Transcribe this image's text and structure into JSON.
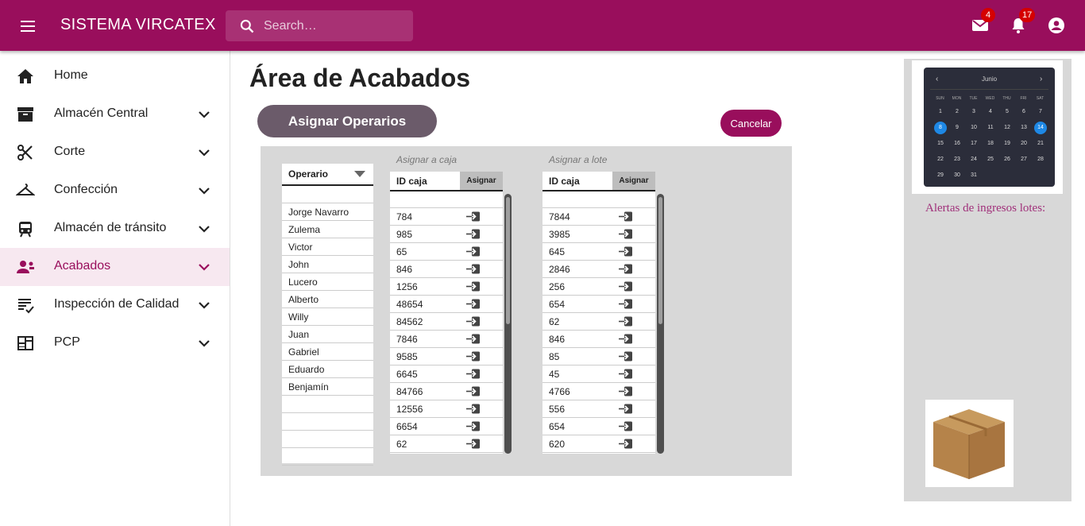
{
  "app": {
    "title": "SISTEMA VIRCATEX",
    "search_placeholder": "Search…",
    "mail_badge": "4",
    "notifications_badge": "17",
    "accent_color": "#990e5c"
  },
  "sidebar": {
    "items": [
      {
        "label": "Home",
        "icon": "home-icon"
      },
      {
        "label": "Almacén Central",
        "icon": "archive-icon"
      },
      {
        "label": "Corte",
        "icon": "scissors-icon"
      },
      {
        "label": "Confección",
        "icon": "hanger-icon"
      },
      {
        "label": "Almacén de tránsito",
        "icon": "train-icon"
      },
      {
        "label": "Acabados",
        "icon": "workers-icon",
        "active": true
      },
      {
        "label": "Inspección de Calidad",
        "icon": "checklist-icon"
      },
      {
        "label": "PCP",
        "icon": "dashboard-icon"
      }
    ]
  },
  "main": {
    "title": "Área de Acabados",
    "assign_button": "Asignar Operarios",
    "cancel_button": "Cancelar",
    "operators": {
      "header": "Operario",
      "items": [
        "Jorge Navarro",
        "Zulema",
        "Victor",
        "John",
        "Lucero",
        "Alberto",
        "Willy",
        "Juan",
        "Gabriel",
        "Eduardo",
        "Benjamín"
      ]
    },
    "box_table": {
      "caption": "Asignar a caja",
      "col_id": "ID caja",
      "col_action": "Asignar",
      "rows": [
        "784",
        "985",
        "65",
        "846",
        "1256",
        "48654",
        "84562",
        "7846",
        "9585",
        "6645",
        "84766",
        "12556",
        "6654",
        "62"
      ]
    },
    "lot_table": {
      "caption": "Asignar a lote",
      "col_id": "ID caja",
      "col_action": "Asignar",
      "rows": [
        "7844",
        "3985",
        "645",
        "2846",
        "256",
        "654",
        "62",
        "846",
        "85",
        "45",
        "4766",
        "556",
        "654",
        "620"
      ]
    }
  },
  "calendar": {
    "month": "Junio",
    "weekdays": [
      "SUN",
      "MON",
      "TUE",
      "WED",
      "THU",
      "FRI",
      "SAT"
    ],
    "weeks": [
      [
        "1",
        "2",
        "3",
        "4",
        "5",
        "6",
        "7"
      ],
      [
        "8",
        "9",
        "10",
        "11",
        "12",
        "13",
        "14"
      ],
      [
        "15",
        "16",
        "17",
        "18",
        "19",
        "20",
        "21"
      ],
      [
        "22",
        "23",
        "24",
        "25",
        "26",
        "27",
        "28"
      ],
      [
        "29",
        "30",
        "31",
        "",
        "",
        "",
        ""
      ]
    ],
    "selected": [
      "8",
      "14"
    ]
  },
  "alerts": {
    "text": "Alertas de ingresos lotes:"
  }
}
